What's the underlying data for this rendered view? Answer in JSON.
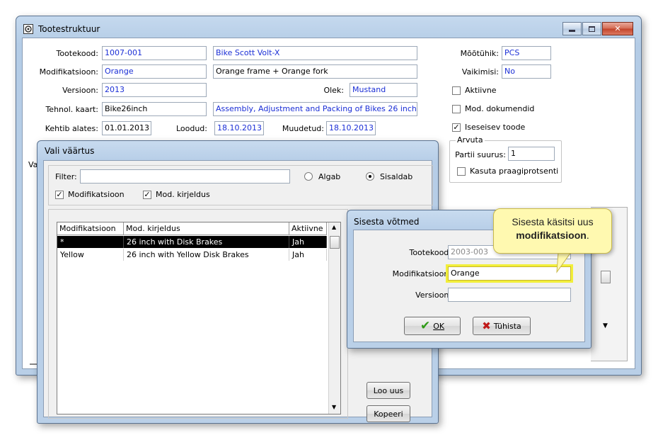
{
  "main_window": {
    "title": "Tootestruktuur",
    "labels": {
      "tootekood": "Tootekood:",
      "modifikatsioon": "Modifikatsioon:",
      "versioon": "Versioon:",
      "tehnol_kaart": "Tehnol. kaart:",
      "kehtib_alates": "Kehtib alates:",
      "loodud": "Loodud:",
      "muudetud": "Muudetud:",
      "olek": "Olek:",
      "mootuhik": "Mõõtühik:",
      "vaikimisi": "Vaikimisi:",
      "partii_suurus": "Partii suurus:",
      "arvuta": "Arvuta",
      "va_fragment": "Va"
    },
    "values": {
      "tootekood": "1007-001",
      "toote_nimi": "Bike Scott Volt-X",
      "modifikatsioon": "Orange",
      "mod_kirjeldus": "Orange frame + Orange fork",
      "versioon": "2013",
      "olek": "Mustand",
      "tehnol_kaart": "Bike26inch",
      "tehnol_kirjeldus": "Assembly, Adjustment and Packing of Bikes 26 inch",
      "kehtib_alates": "01.01.2013",
      "loodud": "18.10.2013",
      "muudetud": "18.10.2013",
      "mootuhik": "PCS",
      "vaikimisi": "No",
      "partii_suurus": "1"
    },
    "checkboxes": [
      {
        "label": "Aktiivne",
        "checked": false
      },
      {
        "label": "Mod. dokumendid",
        "checked": false
      },
      {
        "label": "Iseseisev toode",
        "checked": true
      },
      {
        "label": "Kasuta praagiprotsenti",
        "checked": false
      }
    ]
  },
  "vali_dialog": {
    "title": "Vali väärtus",
    "filter_label": "Filter:",
    "filter_value": "",
    "radio_algab": "Algab",
    "radio_sisaldab": "Sisaldab",
    "selected_radio": "Sisaldab",
    "chk_modifikatsioon": "Modifikatsioon",
    "chk_mod_kirjeldus": "Mod. kirjeldus",
    "columns": [
      "Modifikatsioon",
      "Mod. kirjeldus",
      "Aktiivne"
    ],
    "rows": [
      {
        "mod": "*",
        "desc": "26 inch with Disk Brakes",
        "active": "Jah",
        "selected": true
      },
      {
        "mod": "Yellow",
        "desc": "26 inch with Yellow Disk Brakes",
        "active": "Jah",
        "selected": false
      }
    ],
    "btn_loo_uus": "Loo uus",
    "btn_kopeeri": "Kopeeri"
  },
  "sisesta_dialog": {
    "title": "Sisesta võtmed",
    "label_tootekood": "Tootekood:",
    "label_modifikatsioon": "Modifikatsioon:",
    "label_versioon": "Versioon:",
    "tootekood": "2003-003",
    "modifikatsioon": "Orange",
    "versioon": "",
    "btn_ok": "OK",
    "btn_tuhista": "Tühista"
  },
  "callout": {
    "line1": "Sisesta käsitsi uus",
    "line2": "modifikatsioon",
    "line2_suffix": "."
  },
  "colors": {
    "field_blue_text": "#1b2fd6",
    "callout_bg": "#fff9b0",
    "highlight_glow": "#f2ef3a"
  }
}
